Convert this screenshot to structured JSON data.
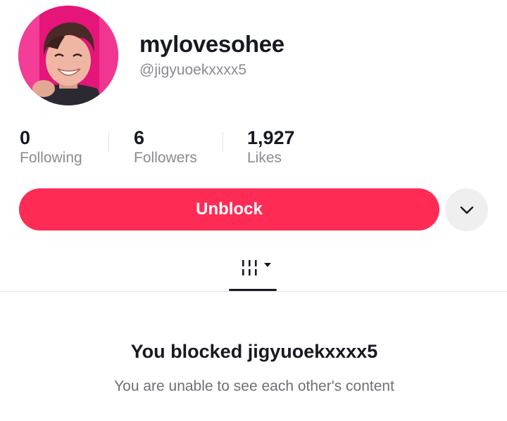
{
  "profile": {
    "display_name": "mylovesohee",
    "handle": "@jigyuoekxxxx5"
  },
  "stats": {
    "following": {
      "value": "0",
      "label": "Following"
    },
    "followers": {
      "value": "6",
      "label": "Followers"
    },
    "likes": {
      "value": "1,927",
      "label": "Likes"
    }
  },
  "actions": {
    "unblock_label": "Unblock",
    "more_icon": "chevron-down-icon"
  },
  "tabs": {
    "videos_icon": "grid-icon"
  },
  "blocked": {
    "title": "You blocked jigyuoekxxxx5",
    "subtitle": "You are unable to see each other's content"
  },
  "colors": {
    "accent": "#fe2c55",
    "text_primary": "#161823",
    "text_secondary": "#8a8b91"
  }
}
